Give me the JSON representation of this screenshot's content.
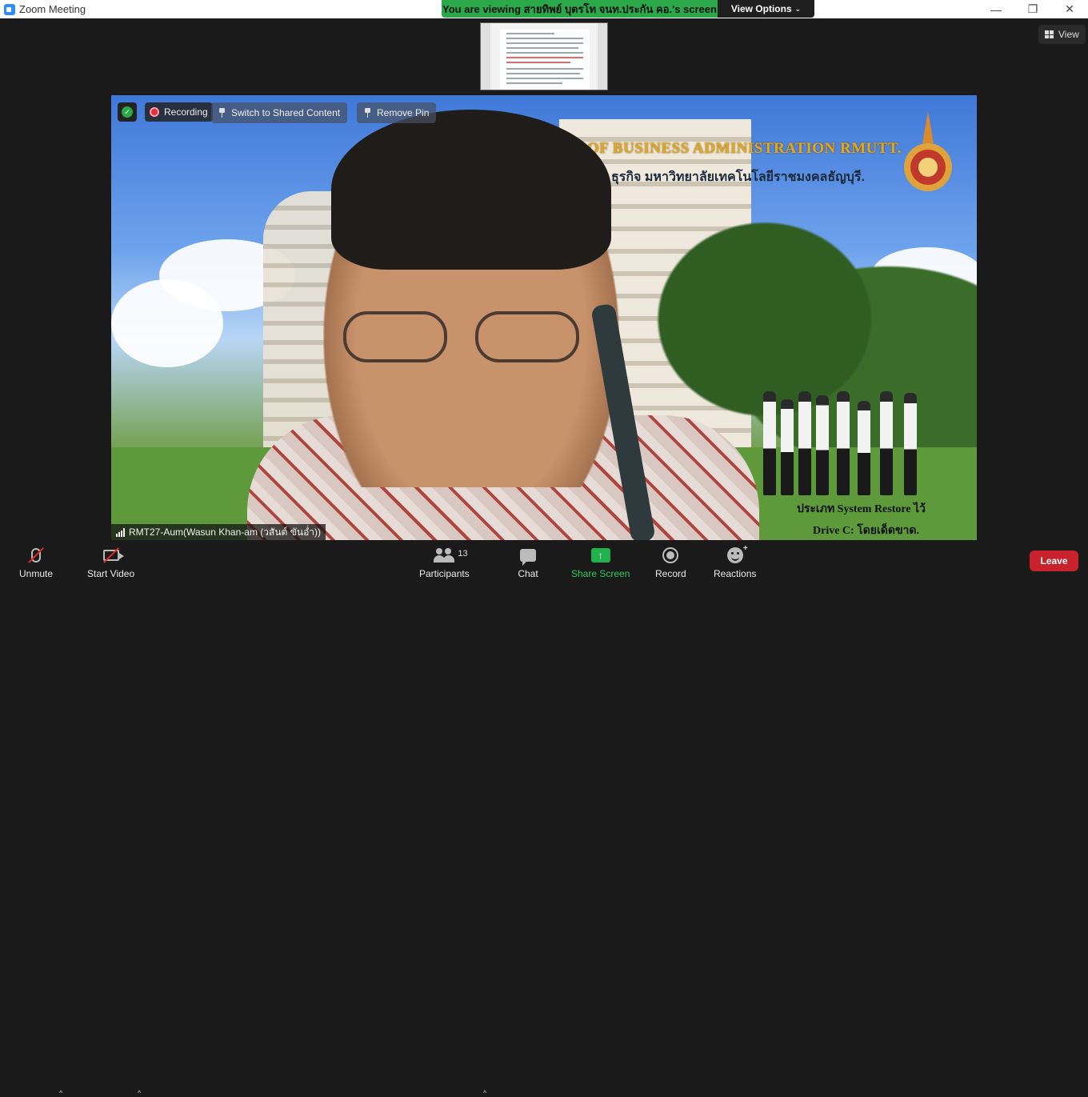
{
  "window": {
    "title": "Zoom Meeting",
    "minimize": "—",
    "restore": "❐",
    "close": "✕"
  },
  "banner": {
    "viewing_text": "You are viewing สายทิพย์ บุตรโท จนท.ประกัน คอ.'s screen",
    "view_options_label": "View Options"
  },
  "view_button": {
    "label": "View"
  },
  "video_overlay": {
    "recording_label": "Recording",
    "switch_label": "Switch to Shared Content",
    "remove_pin_label": "Remove Pin",
    "participant_name": "RMT27-Aum(Wasun Khan-am (วสันต์ ขันอ่ำ))"
  },
  "virtual_background": {
    "line1": "OF BUSINESS ADMINISTRATION RMUTT.",
    "line2": "ธุรกิจ มหาวิทยาลัยเทคโนโลยีราชมงคลธัญบุรี.",
    "line3": "ประเภท System Restore ไว้",
    "line4": "Drive C: โดยเด็ดขาด."
  },
  "toolbar": {
    "unmute": "Unmute",
    "start_video": "Start Video",
    "participants": "Participants",
    "participant_count": "13",
    "chat": "Chat",
    "share_screen": "Share Screen",
    "record": "Record",
    "reactions": "Reactions",
    "leave": "Leave"
  },
  "colors": {
    "accent_green": "#2aa84a",
    "leave_red": "#c8232c",
    "toolbar_bg": "#1a1a1a"
  }
}
